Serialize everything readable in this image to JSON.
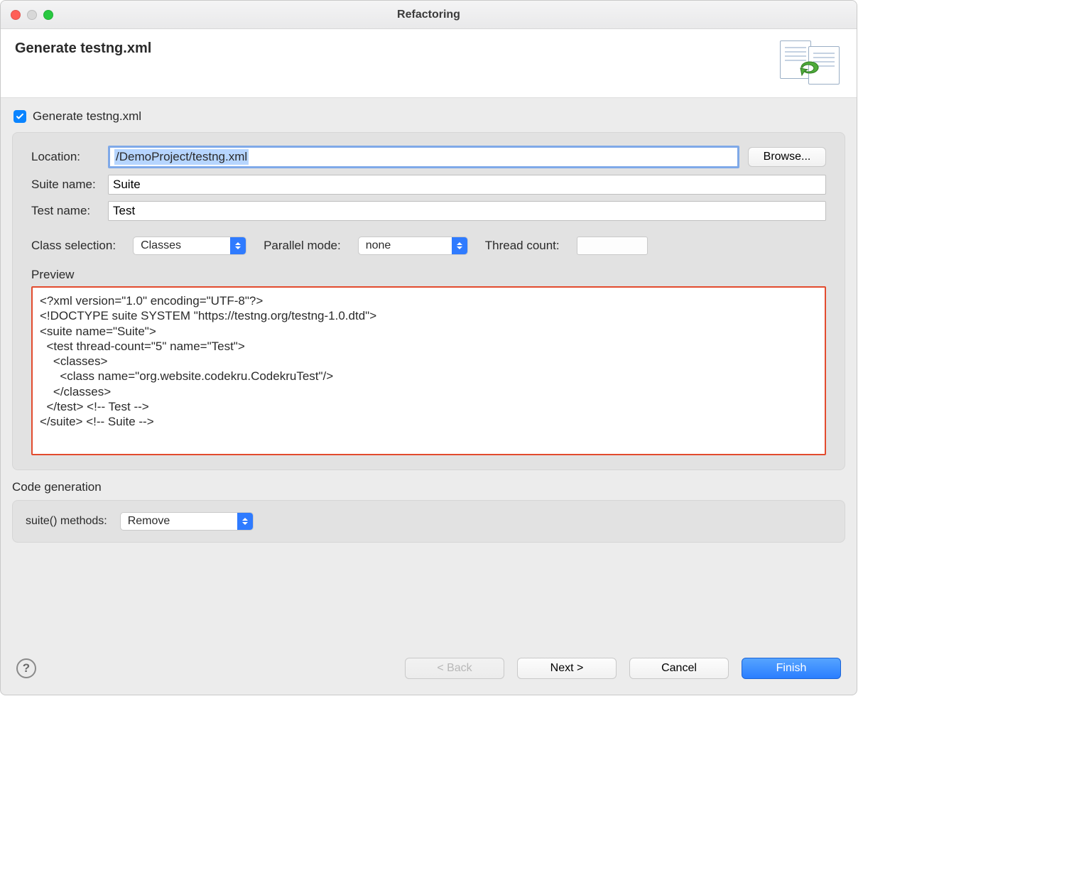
{
  "titlebar": {
    "title": "Refactoring"
  },
  "header": {
    "heading": "Generate testng.xml"
  },
  "generate": {
    "checkbox_label": "Generate testng.xml",
    "checked": true,
    "location_label": "Location:",
    "location_value": "/DemoProject/testng.xml",
    "browse_label": "Browse...",
    "suite_name_label": "Suite name:",
    "suite_name_value": "Suite",
    "test_name_label": "Test name:",
    "test_name_value": "Test",
    "class_selection_label": "Class selection:",
    "class_selection_value": "Classes",
    "parallel_mode_label": "Parallel mode:",
    "parallel_mode_value": "none",
    "thread_count_label": "Thread count:",
    "thread_count_value": "",
    "preview_label": "Preview",
    "preview_text": "<?xml version=\"1.0\" encoding=\"UTF-8\"?>\n<!DOCTYPE suite SYSTEM \"https://testng.org/testng-1.0.dtd\">\n<suite name=\"Suite\">\n  <test thread-count=\"5\" name=\"Test\">\n    <classes>\n      <class name=\"org.website.codekru.CodekruTest\"/>\n    </classes>\n  </test> <!-- Test -->\n</suite> <!-- Suite -->"
  },
  "codegen": {
    "section_label": "Code generation",
    "suite_methods_label": "suite() methods:",
    "suite_methods_value": "Remove"
  },
  "footer": {
    "back_label": "< Back",
    "next_label": "Next >",
    "cancel_label": "Cancel",
    "finish_label": "Finish"
  }
}
